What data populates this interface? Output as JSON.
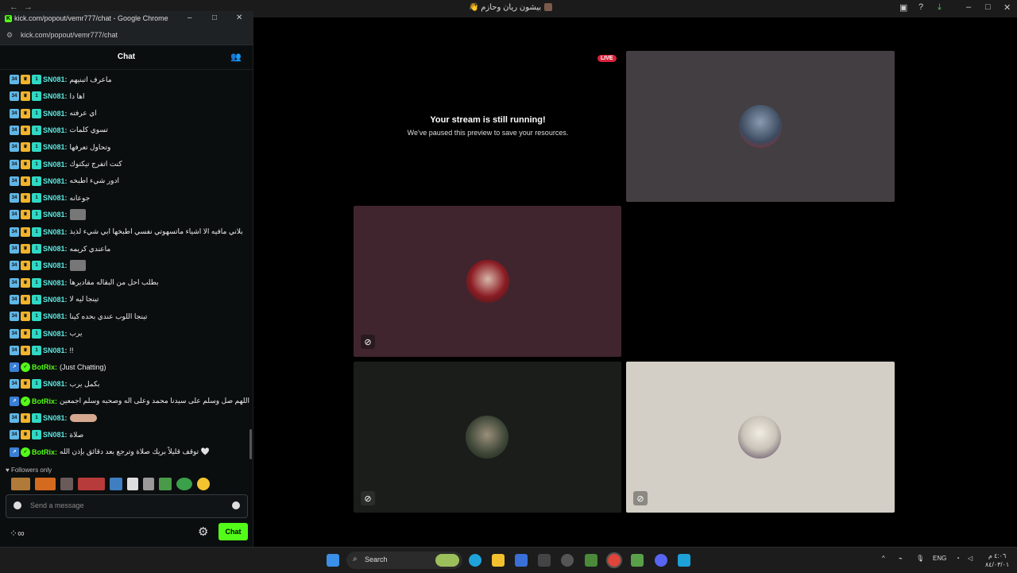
{
  "main_window": {
    "title": "بيشون ريان وحازم 👋"
  },
  "stage": {
    "live_label": "LIVE",
    "paused_title": "Your stream is still running!",
    "paused_subtitle": "We've paused this preview to save your resources."
  },
  "chat_popout": {
    "window_title": "kick.com/popout/vemr777/chat - Google Chrome",
    "url": "kick.com/popout/vemr777/chat",
    "header": "Chat",
    "messages": [
      {
        "user": "SN081:",
        "text": "ماعرف اتبنيهم"
      },
      {
        "user": "SN081:",
        "text": "اها دا"
      },
      {
        "user": "SN081:",
        "text": "اي عرفته"
      },
      {
        "user": "SN081:",
        "text": "تسوي كلمات"
      },
      {
        "user": "SN081:",
        "text": "وتحاول تعرفها"
      },
      {
        "user": "SN081:",
        "text": "كنت اتفرج تيكتوك"
      },
      {
        "user": "SN081:",
        "text": "ادور شيء اطبخه"
      },
      {
        "user": "SN081:",
        "text": "جوعانه"
      },
      {
        "user": "SN081:",
        "text": ""
      },
      {
        "user": "SN081:",
        "text": "بلاني مافيه الا اشياء ماتسهوتي نفسي اطبخها ابي شيء لذيذ"
      },
      {
        "user": "SN081:",
        "text": "ماعندي كريمه"
      },
      {
        "user": "SN081:",
        "text": ""
      },
      {
        "user": "SN081:",
        "text": "بطلب احل من البقاله مقاديرها"
      },
      {
        "user": "SN081:",
        "text": "تينجا ليه لا"
      },
      {
        "user": "SN081:",
        "text": "تينجا اللوب عندي بحده كينا"
      },
      {
        "user": "SN081:",
        "text": "يرب"
      },
      {
        "user": "SN081:",
        "text": "!!"
      },
      {
        "user": "BotRix:",
        "text": "(Just Chatting)"
      },
      {
        "user": "SN081:",
        "text": "بكمل يرب"
      },
      {
        "user": "BotRix:",
        "text": "اللهم صل وسلم على سيدنا محمد وعلى اله وصحبه وسلم اجمعين"
      },
      {
        "user": "SN081:",
        "text": ""
      },
      {
        "user": "SN081:",
        "text": "صلاة"
      },
      {
        "user": "BotRix:",
        "text": "توقف قليلاً بريك صلاة وترجع بعد دقائق بإذن الله 🤍"
      }
    ],
    "badge_sub": "34",
    "badge_gift": "1",
    "followers_only": "♥ Followers only",
    "input_placeholder": "Send a message",
    "points_label": "∞",
    "chat_button": "Chat"
  },
  "taskbar": {
    "search_label": "Search",
    "lang": "ENG",
    "time": "٤:٠٦ م",
    "date": "٨٤/٠٣/٠١"
  },
  "colors": {
    "kick_green": "#53fc18",
    "live_red": "#d9233a",
    "tile_gray": "#433e41",
    "tile_maroon": "#41252e",
    "tile_dark": "#1b1d1b",
    "tile_beige": "#d3cfc6"
  }
}
